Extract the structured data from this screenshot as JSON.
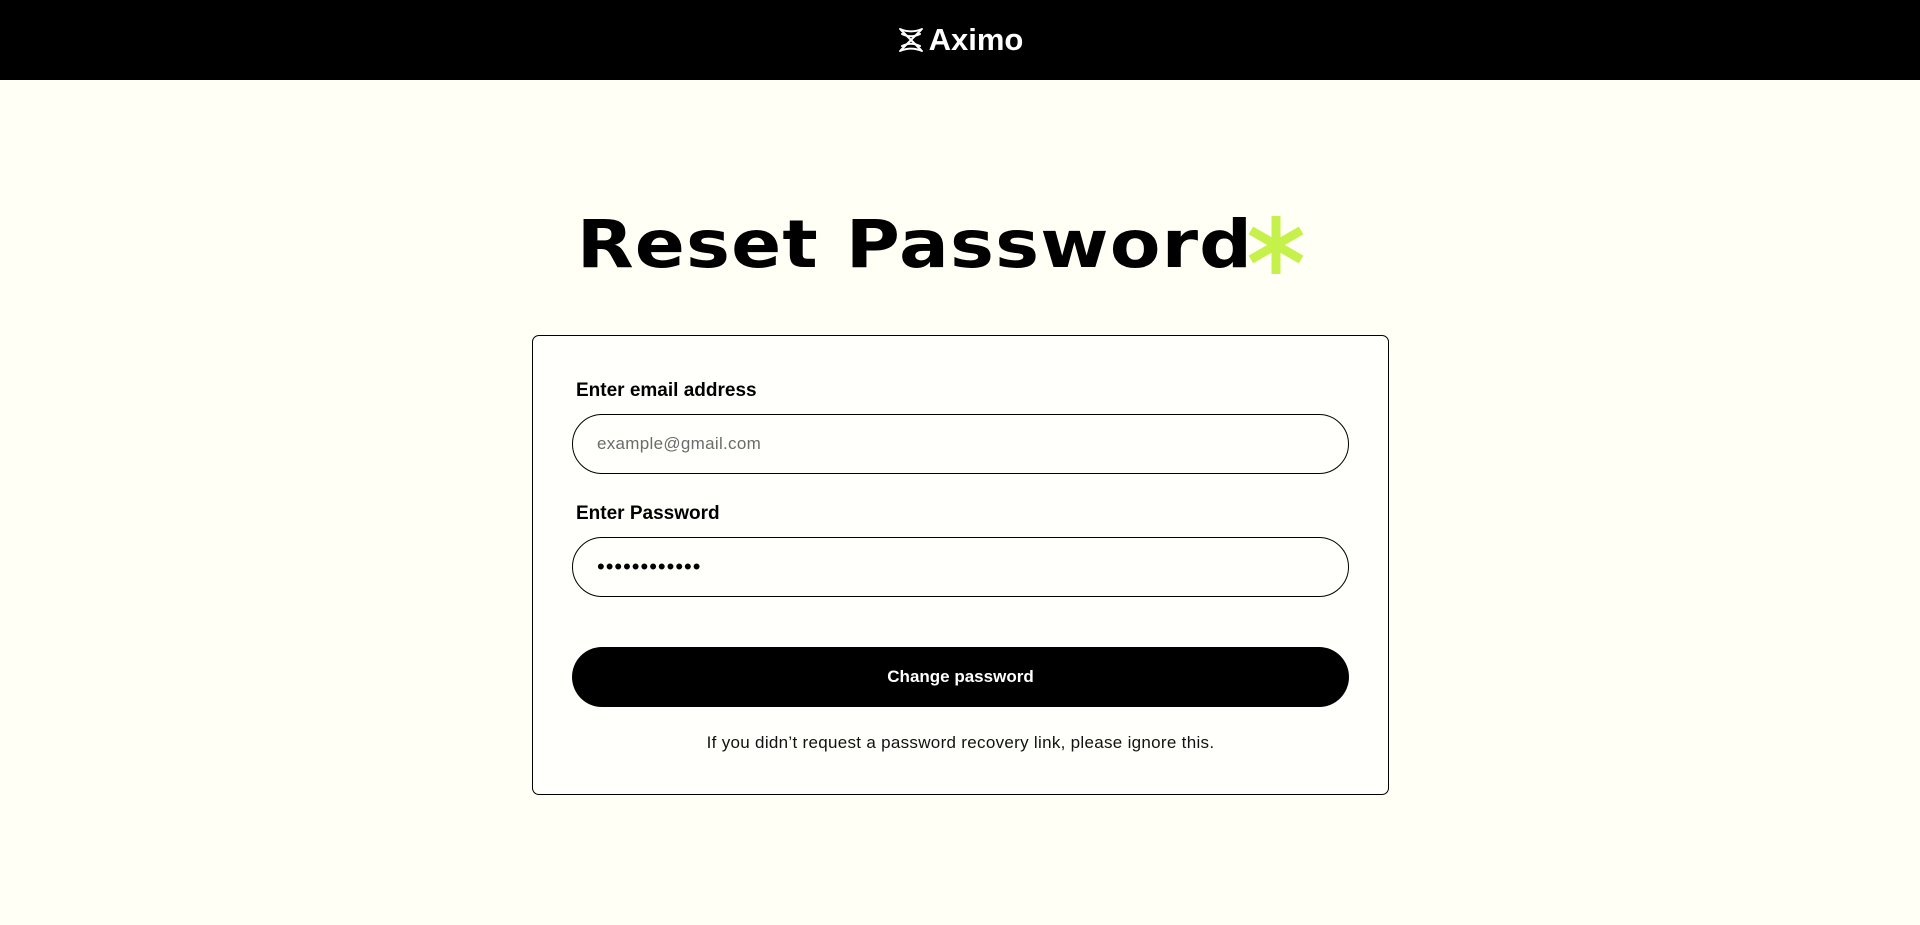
{
  "header": {
    "brand_name": "Aximo",
    "logo_icon": "aximo-logo-icon",
    "background": "#000000"
  },
  "title": {
    "text": "Reset Password",
    "accent_icon": "asterisk-icon",
    "accent_color": "#c6f04a"
  },
  "form": {
    "email_label": "Enter email address",
    "email_placeholder": "example@gmail.com",
    "email_value": "",
    "password_label": "Enter Password",
    "password_value": "••••••••••••",
    "submit_label": "Change password",
    "note": "If you didn’t request a password recovery link, please ignore this."
  }
}
